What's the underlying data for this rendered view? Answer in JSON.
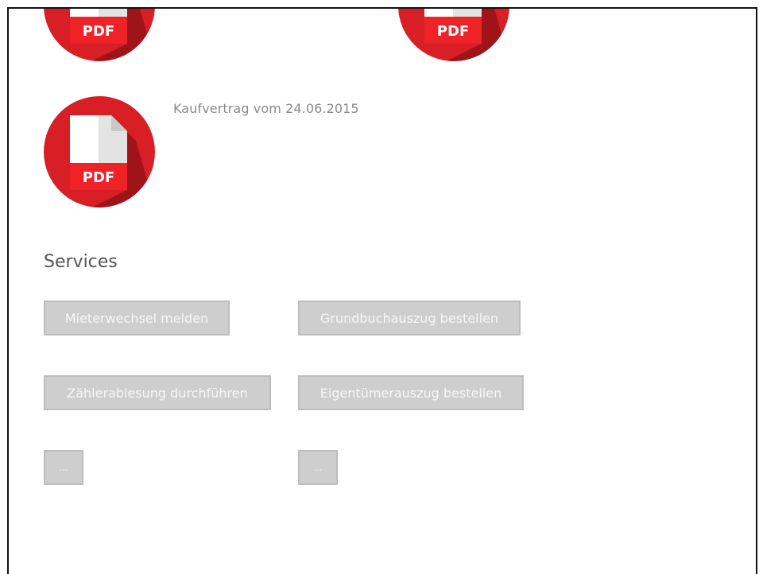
{
  "documents": [
    {
      "label": "PDF",
      "caption": ""
    },
    {
      "label": "PDF",
      "caption": ""
    },
    {
      "label": "PDF",
      "caption": "Kaufvertrag vom 24.06.2015"
    }
  ],
  "services": {
    "title": "Services",
    "buttons": [
      "Mieterwechsel melden",
      "Grundbuchauszug bestellen",
      "Zählerablesung durchführen",
      "Eigentümerauszug bestellen",
      "...",
      "..."
    ]
  },
  "colors": {
    "pdf_red": "#d91f26",
    "pdf_dark_red": "#9f1419",
    "page_white": "#ffffff",
    "page_fold": "#e3e3e3",
    "button_bg": "#cecece"
  },
  "icons": [
    "pdf-file-icon"
  ]
}
